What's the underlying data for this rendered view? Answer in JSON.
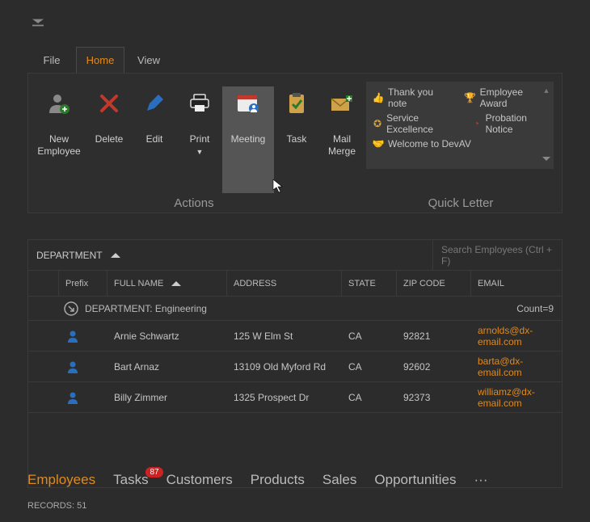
{
  "ribbon_tabs": [
    "File",
    "Home",
    "View"
  ],
  "actions": {
    "new_employee": "New Employee",
    "delete": "Delete",
    "edit": "Edit",
    "print": "Print",
    "meeting": "Meeting",
    "task": "Task",
    "mail_merge": "Mail Merge"
  },
  "group_labels": {
    "actions": "Actions",
    "quick_letter": "Quick Letter"
  },
  "quick_letters": {
    "thank_you": "Thank you note",
    "employee_award": "Employee Award",
    "service_excellence": "Service Excellence",
    "probation_notice": "Probation Notice",
    "welcome": "Welcome to DevAV"
  },
  "grid": {
    "group_field": "DEPARTMENT",
    "search_placeholder": "Search Employees (Ctrl + F)",
    "columns": {
      "prefix": "Prefix",
      "full_name": "FULL NAME",
      "address": "ADDRESS",
      "state": "STATE",
      "zip": "ZIP CODE",
      "email": "EMAIL"
    },
    "group_row": {
      "label": "DEPARTMENT: Engineering",
      "count": "Count=9"
    },
    "rows": [
      {
        "name": "Arnie Schwartz",
        "address": "125 W Elm St",
        "state": "CA",
        "zip": "92821",
        "email": "arnolds@dx-email.com"
      },
      {
        "name": "Bart Arnaz",
        "address": "13109 Old Myford Rd",
        "state": "CA",
        "zip": "92602",
        "email": "barta@dx-email.com"
      },
      {
        "name": "Billy Zimmer",
        "address": "1325 Prospect Dr",
        "state": "CA",
        "zip": "92373",
        "email": "williamz@dx-email.com"
      }
    ]
  },
  "nav": {
    "employees": "Employees",
    "tasks": "Tasks",
    "tasks_badge": "87",
    "customers": "Customers",
    "products": "Products",
    "sales": "Sales",
    "opportunities": "Opportunities",
    "overflow": "···"
  },
  "status": {
    "records_label": "RECORDS: 51"
  }
}
